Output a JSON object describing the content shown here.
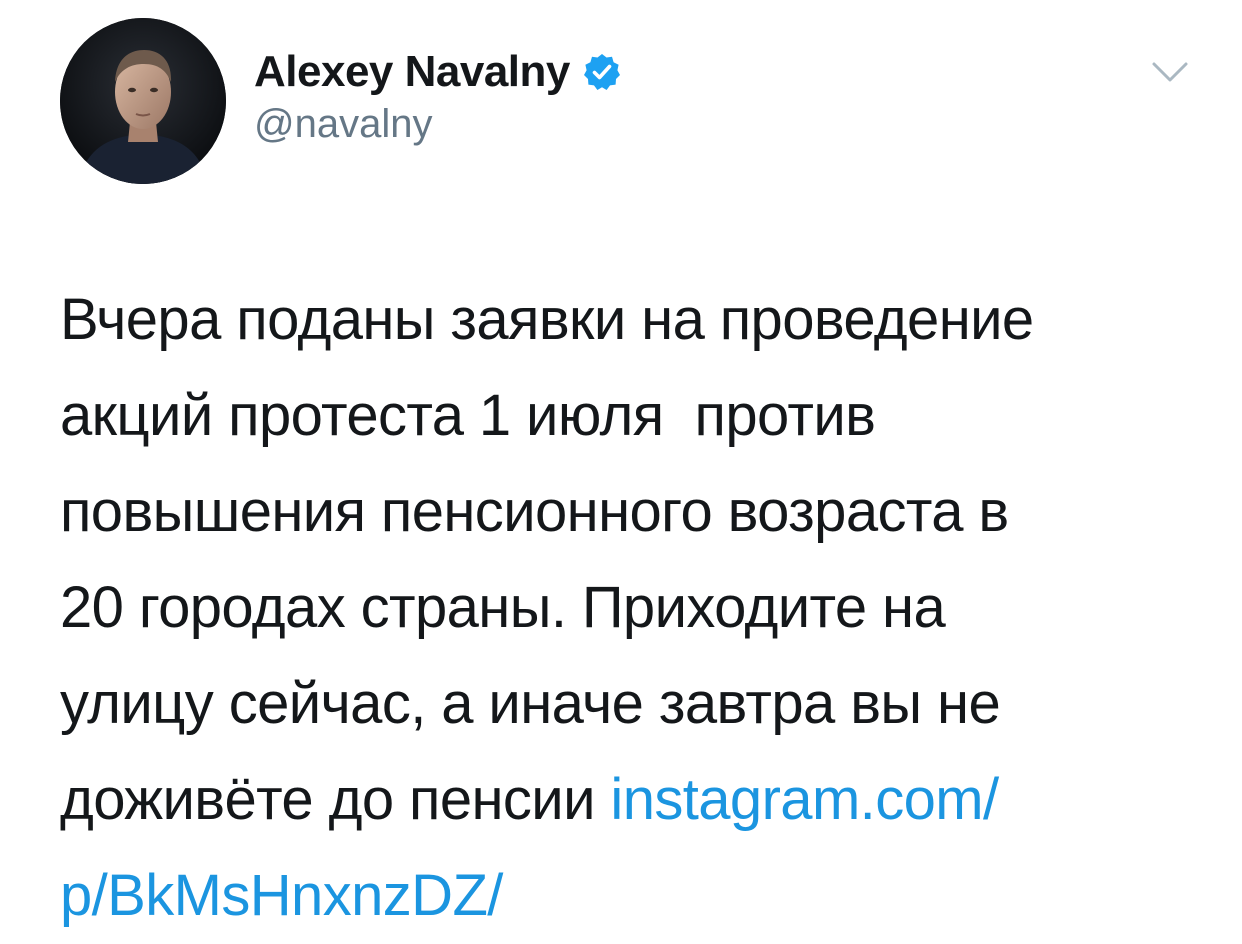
{
  "author": {
    "display_name": "Alexey Navalny",
    "handle": "@navalny",
    "verified": true,
    "avatar_icon": "avatar-photo"
  },
  "tweet": {
    "line1": "Вчера поданы заявки на проведение",
    "line2": "акций протеста 1 июля  против",
    "line3": "повышения пенсионного возраста в",
    "line4": "20 городах страны. Приходите на",
    "line5": "улицу сейчас, а иначе завтра вы не",
    "line6_text": "доживёте до пенсии ",
    "line6_link": "instagram.com/",
    "line7_link": "p/BkMsHnxnzDZ/"
  },
  "icons": {
    "verified": "verified-badge-icon",
    "menu": "chevron-down-icon"
  },
  "colors": {
    "text": "#14171a",
    "secondary": "#657786",
    "link": "#1b95e0",
    "verified": "#1da1f2"
  }
}
